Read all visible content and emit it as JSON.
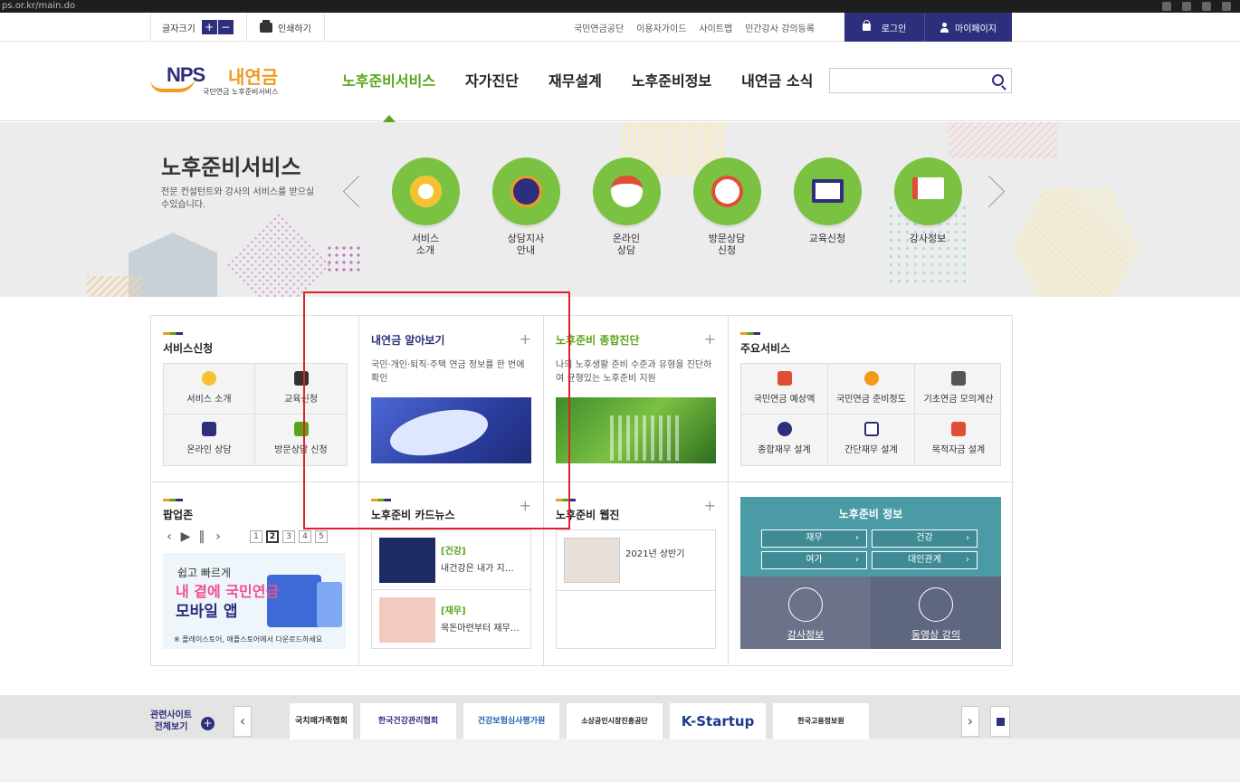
{
  "browser": {
    "url": "ps.or.kr/main.do"
  },
  "utility": {
    "font_size_label": "글자크기",
    "font_plus": "+",
    "font_minus": "−",
    "print_label": "인쇄하기",
    "links": [
      "국민연금공단",
      "이용자가이드",
      "사이트맵",
      "민간강사 강의등록"
    ],
    "login": "로그인",
    "mypage": "마이페이지"
  },
  "header": {
    "logo_nps": "NPS",
    "logo_title": "내연금",
    "logo_sub": "국민연금 노후준비서비스",
    "nav": [
      "노후준비서비스",
      "자가진단",
      "재무설계",
      "노후준비정보",
      "내연금 소식"
    ],
    "search_placeholder": ""
  },
  "hero": {
    "title": "노후준비서비스",
    "desc": "전문 컨설턴트와 강사의 서비스를 받으실 수있습니다.",
    "services": [
      {
        "label": "서비스\n소개",
        "icon": "egg-icon"
      },
      {
        "label": "상담지사\n안내",
        "icon": "globe-pin-icon"
      },
      {
        "label": "온라인\n상담",
        "icon": "mouse-icon"
      },
      {
        "label": "방문상담\n신청",
        "icon": "clock-icon"
      },
      {
        "label": "교육신청",
        "icon": "board-icon"
      },
      {
        "label": "강사정보",
        "icon": "presenter-icon"
      }
    ]
  },
  "panels": {
    "service_apply": {
      "title": "서비스신청",
      "items": [
        "서비스 소개",
        "교육신청",
        "온라인 상담",
        "방문상담 신청"
      ]
    },
    "pension_view": {
      "title": "내연금 알아보기",
      "plus": "+",
      "desc": "국민·개인·퇴직·주택 연금 정보를 한 번에 확인"
    },
    "diagnosis": {
      "title": "노후준비 종합진단",
      "plus": "+",
      "desc": "나의 노후생활 준비 수준과 유형을 진단하여 균형있는 노후준비 지원"
    },
    "main_services": {
      "title": "주요서비스",
      "items": [
        "국민연금 예상액",
        "국민연금 준비정도",
        "기초연금 모의계산",
        "종합재무 설계",
        "간단재무 설계",
        "목적자금 설계"
      ]
    },
    "popup_zone": {
      "title": "팝업존",
      "pages": [
        "1",
        "2",
        "3",
        "4",
        "5"
      ],
      "current_page": "2",
      "banner_line1": "쉽고 빠르게",
      "banner_line2": "내 곁에 국민연금",
      "banner_line3": "모바일 앱",
      "banner_note": "※ 플레이스토어, 애플스토어에서 다운로드하세요"
    },
    "card_news": {
      "title": "노후준비 카드뉴스",
      "plus": "+",
      "items": [
        {
          "tag": "[건강]",
          "text": "내건강은 내가 지…"
        },
        {
          "tag": "[재무]",
          "text": "목돈마련부터 재무…"
        }
      ]
    },
    "webzine": {
      "title": "노후준비 웹진",
      "plus": "+",
      "item": "2021년 상반기"
    },
    "info": {
      "title": "노후준비 정보",
      "buttons": [
        "재무",
        "건강",
        "여가",
        "대인관계"
      ],
      "lecturer": "강사정보",
      "video": "동영상 강의"
    }
  },
  "related": {
    "label_line1": "관련사이트",
    "label_line2": "전체보기",
    "plus": "+",
    "prev": "‹",
    "next": "›",
    "sites": [
      "국치매가족협회",
      "한국건강관리협회",
      "건강보험심사평가원",
      "소상공인시장진흥공단",
      "K-Startup",
      "한국고용정보원"
    ]
  }
}
